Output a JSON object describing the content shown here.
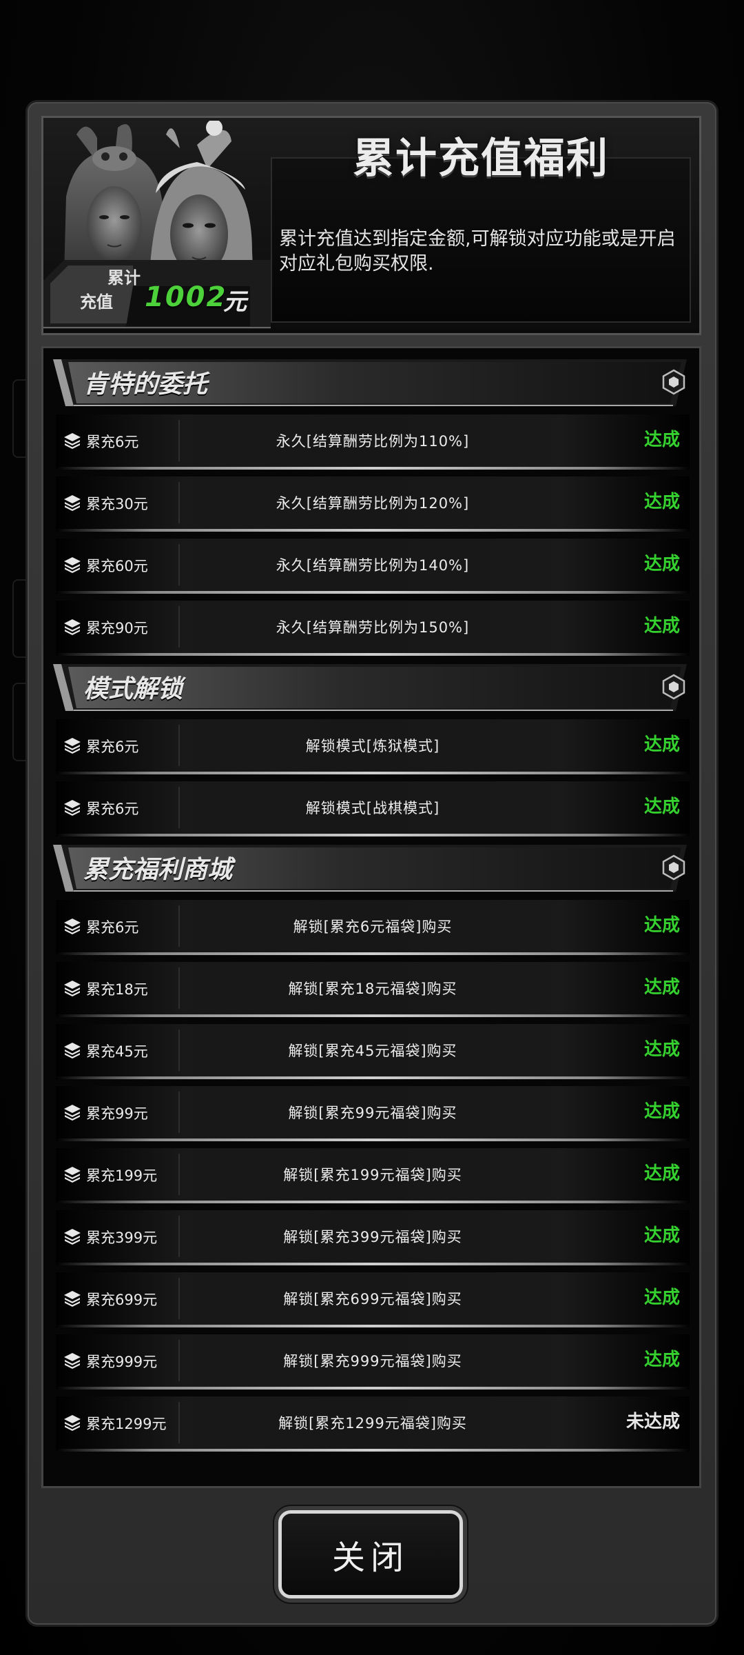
{
  "header": {
    "title": "累计充值福利",
    "description": "累计充值达到指定金额,可解锁对应功能或是开启对应礼包购买权限.",
    "total_label_1": "累计",
    "total_label_2": "充值",
    "total_value": "1002",
    "total_unit": "元"
  },
  "sections": [
    {
      "title": "肯特的委托",
      "rows": [
        {
          "amount": "累充6元",
          "reward": "永久[结算酬劳比例为110%]",
          "status": "达成"
        },
        {
          "amount": "累充30元",
          "reward": "永久[结算酬劳比例为120%]",
          "status": "达成"
        },
        {
          "amount": "累充60元",
          "reward": "永久[结算酬劳比例为140%]",
          "status": "达成"
        },
        {
          "amount": "累充90元",
          "reward": "永久[结算酬劳比例为150%]",
          "status": "达成"
        }
      ]
    },
    {
      "title": "模式解锁",
      "rows": [
        {
          "amount": "累充6元",
          "reward": "解锁模式[炼狱模式]",
          "status": "达成"
        },
        {
          "amount": "累充6元",
          "reward": "解锁模式[战棋模式]",
          "status": "达成"
        }
      ]
    },
    {
      "title": "累充福利商城",
      "rows": [
        {
          "amount": "累充6元",
          "reward": "解锁[累充6元福袋]购买",
          "status": "达成"
        },
        {
          "amount": "累充18元",
          "reward": "解锁[累充18元福袋]购买",
          "status": "达成"
        },
        {
          "amount": "累充45元",
          "reward": "解锁[累充45元福袋]购买",
          "status": "达成"
        },
        {
          "amount": "累充99元",
          "reward": "解锁[累充99元福袋]购买",
          "status": "达成"
        },
        {
          "amount": "累充199元",
          "reward": "解锁[累充199元福袋]购买",
          "status": "达成"
        },
        {
          "amount": "累充399元",
          "reward": "解锁[累充399元福袋]购买",
          "status": "达成"
        },
        {
          "amount": "累充699元",
          "reward": "解锁[累充699元福袋]购买",
          "status": "达成"
        },
        {
          "amount": "累充999元",
          "reward": "解锁[累充999元福袋]购买",
          "status": "达成"
        },
        {
          "amount": "累充1299元",
          "reward": "解锁[累充1299元福袋]购买",
          "status": "未达成"
        }
      ]
    }
  ],
  "close_button": "关闭",
  "colors": {
    "achieved": "#35d12f",
    "total_value": "#4dd13a"
  },
  "icons": {
    "row_icon": "layers-icon",
    "section_icon": "hexagon-badge-icon"
  }
}
